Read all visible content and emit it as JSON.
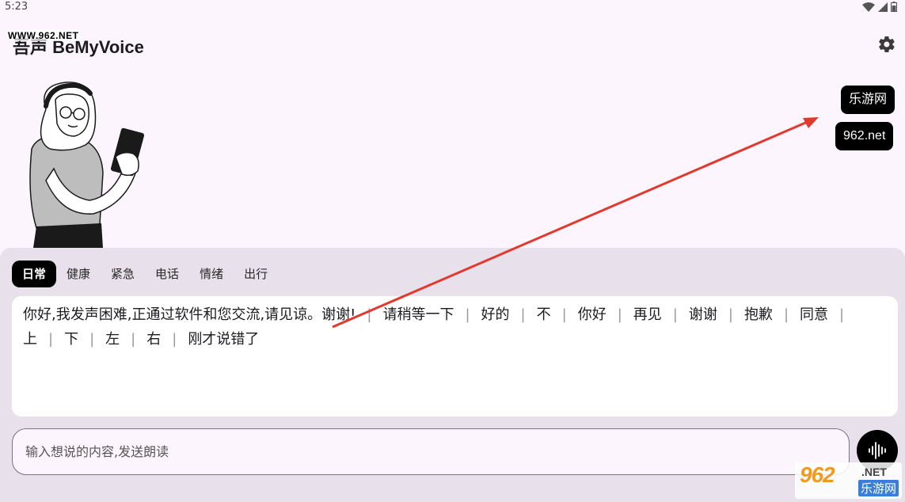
{
  "status_bar": {
    "time": "5:23"
  },
  "app": {
    "title": "吾声 BeMyVoice",
    "watermark_top": "WWW.962.NET"
  },
  "chips": [
    "乐游网",
    "962.net"
  ],
  "tabs": [
    {
      "label": "日常",
      "active": true
    },
    {
      "label": "健康",
      "active": false
    },
    {
      "label": "紧急",
      "active": false
    },
    {
      "label": "电话",
      "active": false
    },
    {
      "label": "情绪",
      "active": false
    },
    {
      "label": "出行",
      "active": false
    }
  ],
  "phrases": [
    "你好,我发声困难,正通过软件和您交流,请见谅。谢谢!",
    "请稍等一下",
    "好的",
    "不",
    "你好",
    "再见",
    "谢谢",
    "抱歉",
    "同意",
    "上",
    "下",
    "左",
    "右",
    "刚才说错了"
  ],
  "input": {
    "placeholder": "输入想说的内容,发送朗读",
    "value": ""
  },
  "icons": {
    "settings": "gear-icon",
    "speak": "sound-wave-icon"
  },
  "watermark_br": {
    "brand": "962",
    "net": ".NET",
    "cn": "乐游网"
  },
  "colors": {
    "background": "#fdf5fd",
    "panel": "#e8e0ea",
    "accent": "#000000",
    "arrow": "#e03a2f"
  }
}
